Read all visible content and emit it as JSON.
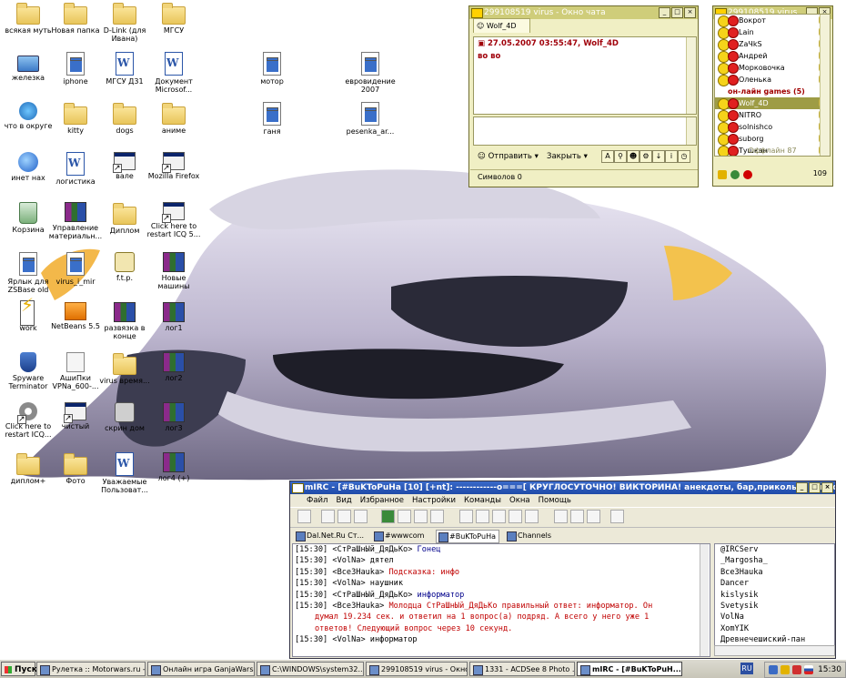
{
  "desktop_icons": [
    {
      "label": "вся&shy;кая муть",
      "kind": "folder"
    },
    {
      "label": "Новая папка",
      "kind": "folder"
    },
    {
      "label": "D-Link (для Ивана)",
      "kind": "folder"
    },
    {
      "label": "МГСУ",
      "kind": "folder"
    },
    {
      "label": "железка",
      "kind": "pc"
    },
    {
      "label": "iphone",
      "kind": "doc"
    },
    {
      "label": "МГСУ Д31",
      "kind": "word"
    },
    {
      "label": "Документ Microsof...",
      "kind": "word"
    },
    {
      "label": "мотор",
      "kind": "doc"
    },
    {
      "label": "евровидение 2007",
      "kind": "doc"
    },
    {
      "label": "что в округе",
      "kind": "net"
    },
    {
      "label": "kitty",
      "kind": "folder"
    },
    {
      "label": "dogs",
      "kind": "folder"
    },
    {
      "label": "аниме",
      "kind": "folder"
    },
    {
      "label": "ганя",
      "kind": "doc"
    },
    {
      "label": "pesenka_ar...",
      "kind": "doc"
    },
    {
      "label": "инет нах",
      "kind": "ie"
    },
    {
      "label": "логистика",
      "kind": "word"
    },
    {
      "label": "вале",
      "kind": "app"
    },
    {
      "label": "Mozilla Firefox",
      "kind": "app"
    },
    {
      "label": "Корзина",
      "kind": "bin"
    },
    {
      "label": "Управление материальн...",
      "kind": "rar"
    },
    {
      "label": "Диплом",
      "kind": "folder"
    },
    {
      "label": "Click here to restart ICQ 5...",
      "kind": "app"
    },
    {
      "label": "Ярлык для ZSBase old",
      "kind": "doc"
    },
    {
      "label": "virus_i_mir",
      "kind": "doc"
    },
    {
      "label": "f.t.p.",
      "kind": "ftp"
    },
    {
      "label": "Новые машины",
      "kind": "rar"
    },
    {
      "label": "work",
      "kind": "bolt"
    },
    {
      "label": "NetBeans 5.5",
      "kind": "nb"
    },
    {
      "label": "развязка в конце",
      "kind": "rar"
    },
    {
      "label": "лог1",
      "kind": "rar"
    },
    {
      "label": "Spyware Terminator",
      "kind": "shield"
    },
    {
      "label": "АшиПки VPNa_600-...",
      "kind": "sz"
    },
    {
      "label": "virus время...",
      "kind": "folder"
    },
    {
      "label": "лог2",
      "kind": "rar"
    },
    {
      "label": "Click here to restart ICQ...",
      "kind": "gear"
    },
    {
      "label": "чистый",
      "kind": "app"
    },
    {
      "label": "скрин дом",
      "kind": "cam"
    },
    {
      "label": "лог3",
      "kind": "rar"
    },
    {
      "label": "диплом+",
      "kind": "folder"
    },
    {
      "label": "Фото",
      "kind": "folder"
    },
    {
      "label": "Уважаемые Пользоват...",
      "kind": "word"
    },
    {
      "label": "лог4 (+)",
      "kind": "rar"
    }
  ],
  "icq_chat": {
    "title": "299108519 virus - Окно чата",
    "tab": "Wolf_4D",
    "message_header": "27.05.2007 03:55:47, Wolf_4D",
    "message_text": "во во",
    "send_label": "Отправить",
    "close_label": "Закрыть",
    "chars_label": "Символов 0",
    "buttons": {
      "min": "_",
      "max": "□",
      "close": "×"
    }
  },
  "icq_list": {
    "title": "299108519 virus",
    "contacts": [
      {
        "name": "Вокрот",
        "type": "contact"
      },
      {
        "name": "Lain",
        "type": "contact"
      },
      {
        "name": "ZaЧkS",
        "type": "contact"
      },
      {
        "name": "Андрей",
        "type": "contact"
      },
      {
        "name": "Морковочка",
        "type": "contact"
      },
      {
        "name": "Оленька",
        "type": "contact"
      },
      {
        "name": "он-лайн games (5)",
        "type": "group"
      },
      {
        "name": "Wolf_4D",
        "type": "selected"
      },
      {
        "name": "NITRO",
        "type": "contact"
      },
      {
        "name": "solnishco",
        "type": "contact"
      },
      {
        "name": "suborg",
        "type": "contact"
      },
      {
        "name": "Тушкан",
        "type": "contact"
      }
    ],
    "offline_label": "Оффлайн 87",
    "count": "109"
  },
  "mirc": {
    "title": "mIRC - [#BuKToPuHa [10] [+nt]: ------------o===[ КРУГЛОСУТОЧНО! ВИКТОРИНА! анекдоты, бар,приколы и многое другое --",
    "menu": [
      "Файл",
      "Вид",
      "Избранное",
      "Настройки",
      "Команды",
      "Окна",
      "Помощь"
    ],
    "switchbar": [
      "Dal.Net.Ru Ст...",
      "#wwwcom",
      "#BuKToPuHa",
      "Channels"
    ],
    "log": [
      {
        "time": "[15:30]",
        "nick": "<СтРаШнЫй_ДяДьКо>",
        "text": " Гонец",
        "color": "blue"
      },
      {
        "time": "[15:30]",
        "nick": "<VolNa>",
        "text": " дятел",
        "color": "black"
      },
      {
        "time": "[15:30]",
        "nick": "<Все3Наuka>",
        "text": " Подсказка: инфо",
        "color": "red"
      },
      {
        "time": "[15:30]",
        "nick": "<VolNa>",
        "text": " наушник",
        "color": "black"
      },
      {
        "time": "[15:30]",
        "nick": "<СтРаШнЫй_ДяДьКо>",
        "text": " информатор",
        "color": "blue"
      },
      {
        "time": "[15:30]",
        "nick": "<Все3Наuka>",
        "text": " Молодца СтРаШнЫй_ДяДьКо правильный ответ: информатор. Он",
        "color": "red"
      },
      {
        "time": "",
        "nick": "",
        "text": "думал 19.234 сек. и ответил на 1 вопрос(а) подряд. А всего у него уже 1",
        "color": "red"
      },
      {
        "time": "",
        "nick": "",
        "text": "ответов! Следующий вопрос через 10 секунд.",
        "color": "red"
      },
      {
        "time": "[15:30]",
        "nick": "<VolNa>",
        "text": " информатор",
        "color": "black"
      }
    ],
    "nicks": [
      "@IRCServ",
      "_Margosha_",
      "Все3Наuka",
      "Dancer",
      "kislysik",
      "Svetysik",
      "VolNa",
      "XomYIK",
      "Древнечешиский-пан"
    ]
  },
  "taskbar": {
    "start": "Пуск",
    "tasks": [
      {
        "label": "Рулетка :: Motorwars.ru - ...",
        "active": false
      },
      {
        "label": "Онлайн игра GanjaWars...",
        "active": false
      },
      {
        "label": "C:\\WINDOWS\\system32...",
        "active": false
      },
      {
        "label": "299108519 virus - Окно ч...",
        "active": false
      },
      {
        "label": "1331 - ACDSee 8 Photo ...",
        "active": false
      },
      {
        "label": "mIRC - [#BuKToPuH...",
        "active": true
      }
    ],
    "lang": "RU",
    "clock": "15:30"
  }
}
